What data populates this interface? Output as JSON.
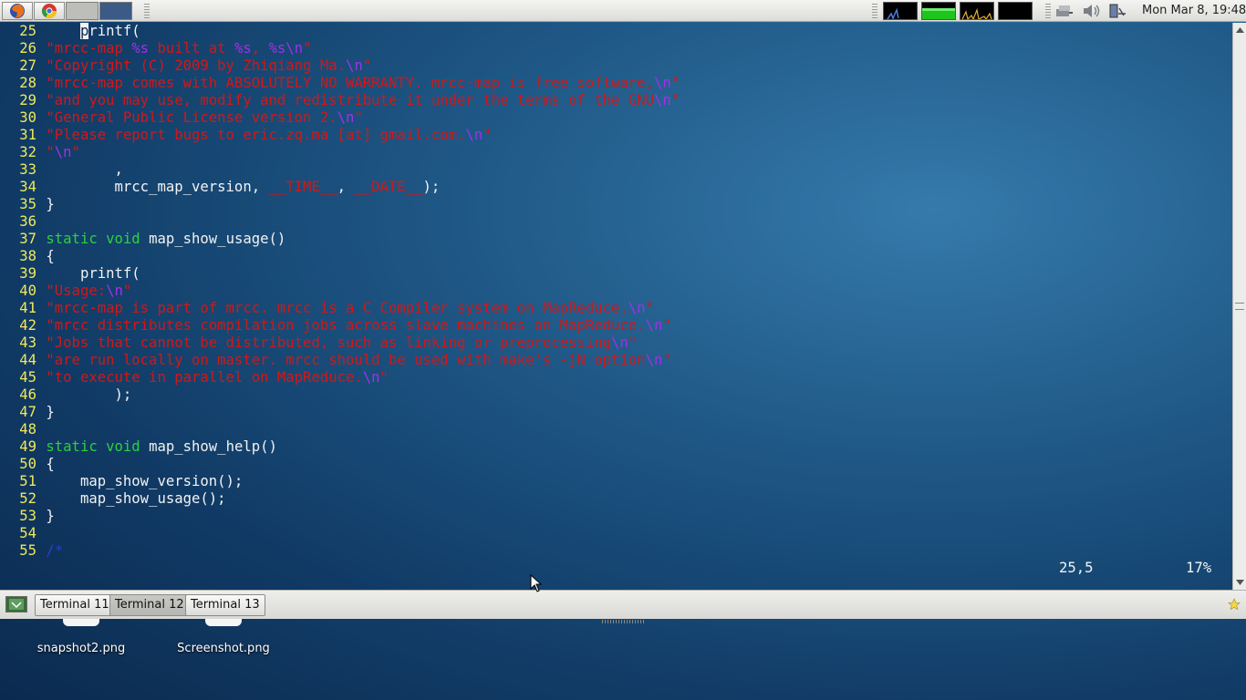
{
  "top_panel": {
    "launchers": [
      {
        "name": "firefox-launcher",
        "icon": "firefox-icon"
      },
      {
        "name": "chrome-launcher",
        "icon": "chrome-icon"
      }
    ],
    "workspaces": 2,
    "clock": "Mon Mar  8, 19:48",
    "tray_icons": [
      "network-icon",
      "volume-icon",
      "battery-icon"
    ]
  },
  "editor": {
    "lines": [
      {
        "n": "25",
        "parts": [
          {
            "t": "    ",
            "c": "def"
          },
          {
            "t": "p",
            "c": "cursor"
          },
          {
            "t": "rintf(",
            "c": "def"
          }
        ]
      },
      {
        "n": "26",
        "parts": [
          {
            "t": "\"mrcc-map ",
            "c": "str"
          },
          {
            "t": "%s",
            "c": "esc"
          },
          {
            "t": " built at ",
            "c": "str"
          },
          {
            "t": "%s",
            "c": "esc"
          },
          {
            "t": ", ",
            "c": "str"
          },
          {
            "t": "%s\\n",
            "c": "esc"
          },
          {
            "t": "\"",
            "c": "str"
          }
        ]
      },
      {
        "n": "27",
        "parts": [
          {
            "t": "\"Copyright (C) 2009 by Zhiqiang Ma.",
            "c": "str"
          },
          {
            "t": "\\n",
            "c": "esc"
          },
          {
            "t": "\"",
            "c": "str"
          }
        ]
      },
      {
        "n": "28",
        "parts": [
          {
            "t": "\"mrcc-map comes with ABSOLUTELY NO WARRANTY. mrcc-map is free software,",
            "c": "str"
          },
          {
            "t": "\\n",
            "c": "esc"
          },
          {
            "t": "\"",
            "c": "str"
          }
        ]
      },
      {
        "n": "29",
        "parts": [
          {
            "t": "\"and you may use, modify and redistribute it under the terms of the GNU",
            "c": "str"
          },
          {
            "t": "\\n",
            "c": "esc"
          },
          {
            "t": "\"",
            "c": "str"
          }
        ]
      },
      {
        "n": "30",
        "parts": [
          {
            "t": "\"General Public License version 2.",
            "c": "str"
          },
          {
            "t": "\\n",
            "c": "esc"
          },
          {
            "t": "\"",
            "c": "str"
          }
        ]
      },
      {
        "n": "31",
        "parts": [
          {
            "t": "\"Please report bugs to eric.zq.ma [at] gmail.com.",
            "c": "str"
          },
          {
            "t": "\\n",
            "c": "esc"
          },
          {
            "t": "\"",
            "c": "str"
          }
        ]
      },
      {
        "n": "32",
        "parts": [
          {
            "t": "\"",
            "c": "str"
          },
          {
            "t": "\\n",
            "c": "esc"
          },
          {
            "t": "\"",
            "c": "str"
          }
        ]
      },
      {
        "n": "33",
        "parts": [
          {
            "t": "        ,",
            "c": "def"
          }
        ]
      },
      {
        "n": "34",
        "parts": [
          {
            "t": "        mrcc_map_version, ",
            "c": "def"
          },
          {
            "t": "__TIME__",
            "c": "str"
          },
          {
            "t": ", ",
            "c": "def"
          },
          {
            "t": "__DATE__",
            "c": "str"
          },
          {
            "t": ");",
            "c": "def"
          }
        ]
      },
      {
        "n": "35",
        "parts": [
          {
            "t": "}",
            "c": "def"
          }
        ]
      },
      {
        "n": "36",
        "parts": []
      },
      {
        "n": "37",
        "parts": [
          {
            "t": "static",
            "c": "kw"
          },
          {
            "t": " ",
            "c": "def"
          },
          {
            "t": "void",
            "c": "kw"
          },
          {
            "t": " map_show_usage()",
            "c": "def"
          }
        ]
      },
      {
        "n": "38",
        "parts": [
          {
            "t": "{",
            "c": "def"
          }
        ]
      },
      {
        "n": "39",
        "parts": [
          {
            "t": "    printf(",
            "c": "def"
          }
        ]
      },
      {
        "n": "40",
        "parts": [
          {
            "t": "\"Usage:",
            "c": "str"
          },
          {
            "t": "\\n",
            "c": "esc"
          },
          {
            "t": "\"",
            "c": "str"
          }
        ]
      },
      {
        "n": "41",
        "parts": [
          {
            "t": "\"mrcc-map is part of mrcc. mrcc is a C Compiler system on MapReduce.",
            "c": "str"
          },
          {
            "t": "\\n",
            "c": "esc"
          },
          {
            "t": "\"",
            "c": "str"
          }
        ]
      },
      {
        "n": "42",
        "parts": [
          {
            "t": "\"mrcc distributes compilation jobs across slave machines on MapReduce.",
            "c": "str"
          },
          {
            "t": "\\n",
            "c": "esc"
          },
          {
            "t": "\"",
            "c": "str"
          }
        ]
      },
      {
        "n": "43",
        "parts": [
          {
            "t": "\"Jobs that cannot be distributed, such as linking or preprocessing",
            "c": "str"
          },
          {
            "t": "\\n",
            "c": "esc"
          },
          {
            "t": "\"",
            "c": "str"
          }
        ]
      },
      {
        "n": "44",
        "parts": [
          {
            "t": "\"are run locally on master. mrcc should be used with make's -jN option",
            "c": "str"
          },
          {
            "t": "\\n",
            "c": "esc"
          },
          {
            "t": "\"",
            "c": "str"
          }
        ]
      },
      {
        "n": "45",
        "parts": [
          {
            "t": "\"to execute in parallel on MapReduce.",
            "c": "str"
          },
          {
            "t": "\\n",
            "c": "esc"
          },
          {
            "t": "\"",
            "c": "str"
          }
        ]
      },
      {
        "n": "46",
        "parts": [
          {
            "t": "        );",
            "c": "def"
          }
        ]
      },
      {
        "n": "47",
        "parts": [
          {
            "t": "}",
            "c": "def"
          }
        ]
      },
      {
        "n": "48",
        "parts": []
      },
      {
        "n": "49",
        "parts": [
          {
            "t": "static",
            "c": "kw"
          },
          {
            "t": " ",
            "c": "def"
          },
          {
            "t": "void",
            "c": "kw"
          },
          {
            "t": " map_show_help()",
            "c": "def"
          }
        ]
      },
      {
        "n": "50",
        "parts": [
          {
            "t": "{",
            "c": "def"
          }
        ]
      },
      {
        "n": "51",
        "parts": [
          {
            "t": "    map_show_version();",
            "c": "def"
          }
        ]
      },
      {
        "n": "52",
        "parts": [
          {
            "t": "    map_show_usage();",
            "c": "def"
          }
        ]
      },
      {
        "n": "53",
        "parts": [
          {
            "t": "}",
            "c": "def"
          }
        ]
      },
      {
        "n": "54",
        "parts": []
      },
      {
        "n": "55",
        "parts": [
          {
            "t": "/*",
            "c": "cm"
          }
        ]
      }
    ],
    "status_position": "25,5",
    "status_percent": "17%"
  },
  "taskbar": {
    "tasks": [
      {
        "label": "Terminal 11",
        "active": false
      },
      {
        "label": "Terminal 12",
        "active": true
      },
      {
        "label": "Terminal 13",
        "active": false
      }
    ]
  },
  "desktop": {
    "icons": [
      {
        "label": "snapshot2.png"
      },
      {
        "label": "Screenshot.png"
      }
    ]
  }
}
